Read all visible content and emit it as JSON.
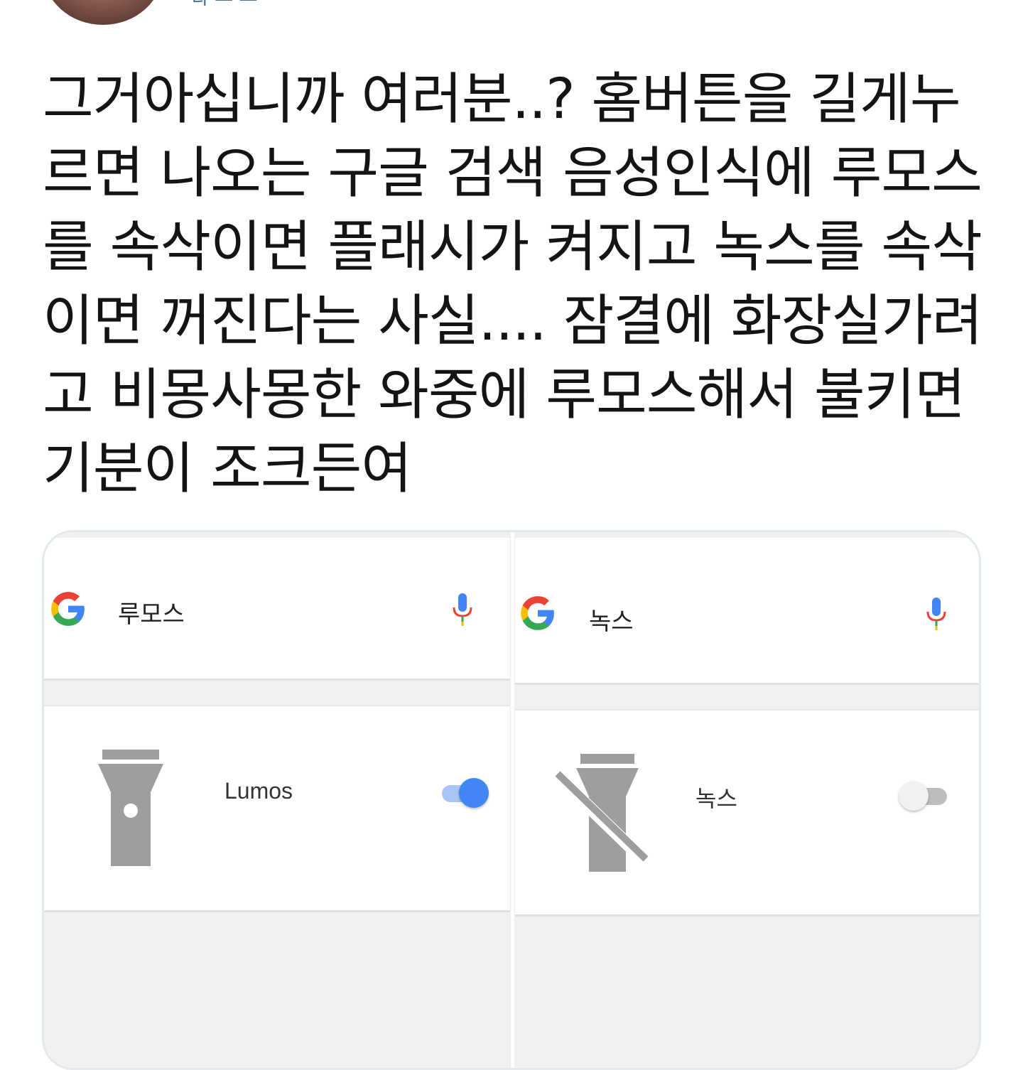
{
  "tweet": {
    "author_fragment": "다 — — ·",
    "text": "그거아십니까 여러분..? 홈버튼을 길게누르면 나오는 구글 검색 음성인식에 루모스를 속삭이면 플래시가 켜지고 녹스를 속삭이면 꺼진다는 사실.... 잠결에 화장실가려고 비몽사몽한 와중에 루모스해서 불키면 기분이 조크든여"
  },
  "panels": {
    "left": {
      "query": "루모스",
      "row_label": "Lumos",
      "toggle_state": "on",
      "icon": "flashlight-on-icon"
    },
    "right": {
      "query": "녹스",
      "row_label": "녹스",
      "toggle_state": "off",
      "icon": "flashlight-off-icon"
    }
  },
  "colors": {
    "google_blue": "#4285f4",
    "google_red": "#ea4335",
    "google_yellow": "#fbbc05",
    "google_green": "#34a853",
    "icon_gray": "#9e9e9e",
    "text": "#141414"
  }
}
